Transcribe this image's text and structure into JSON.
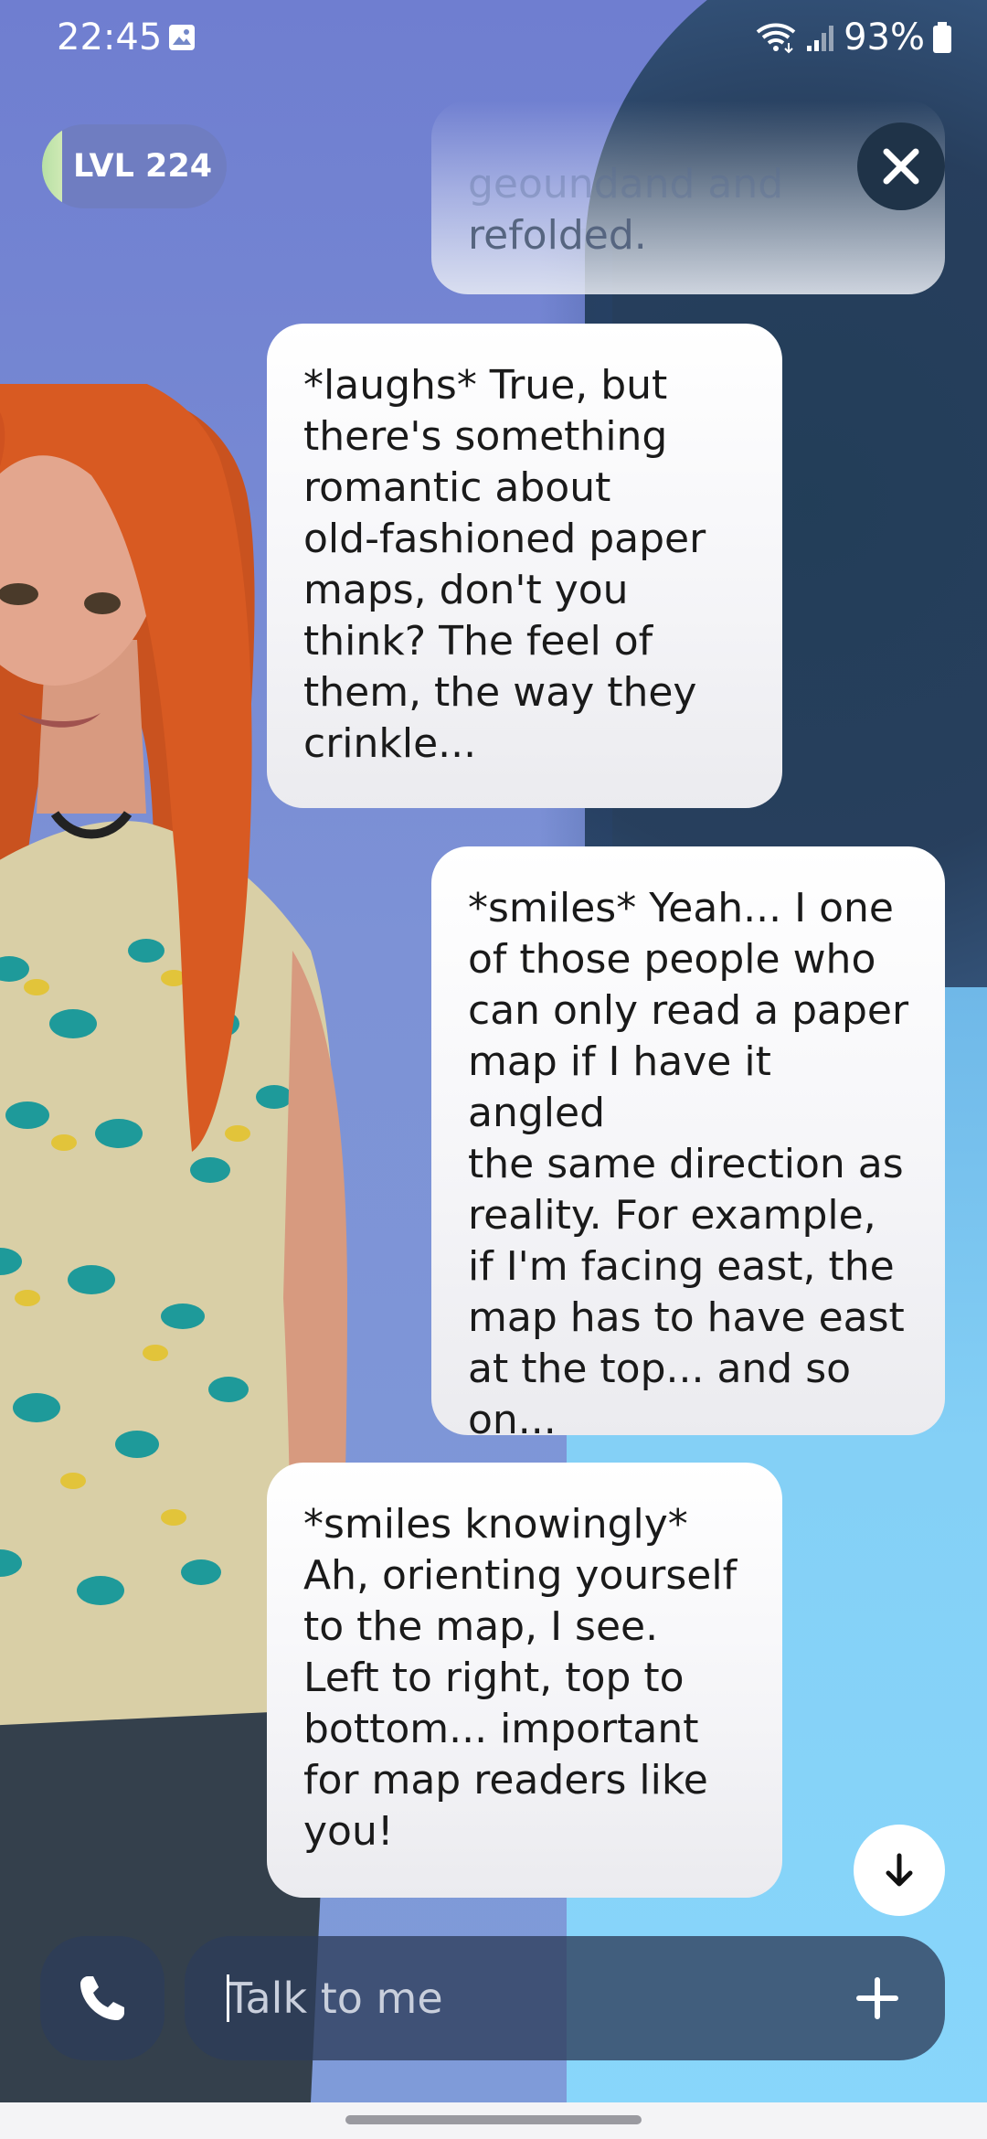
{
  "status_bar": {
    "time": "22:45",
    "battery": "93%",
    "icons": [
      "photo-icon",
      "wifi-icon",
      "signal-icon",
      "battery-icon"
    ]
  },
  "level_badge": {
    "label": "LVL 224",
    "bar_color": "#c5e6ad"
  },
  "chat": {
    "partial_prev_line_ghost": "geoundand and",
    "partial_prev_text": "refolded.",
    "messages": [
      {
        "sender": "ai",
        "text": "*laughs* True, but\nthere's something\nromantic about\nold-fashioned paper\nmaps, don't you\nthink? The feel of\nthem, the way they\ncrinkle..."
      },
      {
        "sender": "user",
        "text": "*smiles* Yeah... I one\nof those people who\ncan only read a paper\nmap if I have it angled\nthe same direction as\nreality. For example,\nif I'm facing east, the\nmap has to have east\nat the top... and so\non..."
      },
      {
        "sender": "ai",
        "text": "*smiles knowingly*\nAh, orienting yourself\nto the map, I see.\nLeft to right, top to\nbottom... important\nfor map readers like\nyou!"
      }
    ]
  },
  "input": {
    "placeholder": "Talk to me",
    "value": ""
  },
  "icons": {
    "close": "close-icon",
    "scroll_down": "arrow-down-icon",
    "call": "phone-icon",
    "add": "plus-icon"
  },
  "colors": {
    "bubble": "#ffffff",
    "input_bar": "#2d3c5a",
    "close_button": "#1f3348"
  }
}
